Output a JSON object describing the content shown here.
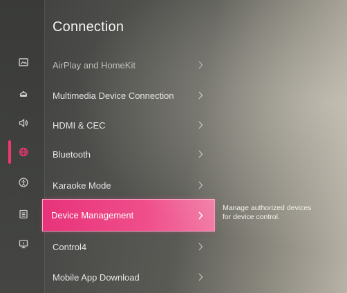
{
  "page": {
    "title": "Connection"
  },
  "colors": {
    "accent": "#ec3f82",
    "rail_active": "#f0386f"
  },
  "sidebar": {
    "icons": [
      {
        "name": "picture-icon",
        "active": false
      },
      {
        "name": "sound-mode-icon",
        "active": false
      },
      {
        "name": "speaker-icon",
        "active": false
      },
      {
        "name": "globe-connection-icon",
        "active": true
      },
      {
        "name": "accessibility-icon",
        "active": false
      },
      {
        "name": "list-icon",
        "active": false
      },
      {
        "name": "monitor-info-icon",
        "active": false
      }
    ]
  },
  "menu": {
    "items": [
      {
        "label": "AirPlay and HomeKit",
        "selected": false
      },
      {
        "label": "Multimedia Device Connection",
        "selected": false
      },
      {
        "label": "HDMI & CEC",
        "selected": false
      },
      {
        "label": "Bluetooth",
        "selected": false
      },
      {
        "label": "Karaoke Mode",
        "selected": false
      },
      {
        "label": "Device Management",
        "selected": true
      },
      {
        "label": "Control4",
        "selected": false
      },
      {
        "label": "Mobile App Download",
        "selected": false
      }
    ],
    "selected_description": {
      "line1": "Manage authorized devices",
      "line2": "for device control."
    }
  }
}
